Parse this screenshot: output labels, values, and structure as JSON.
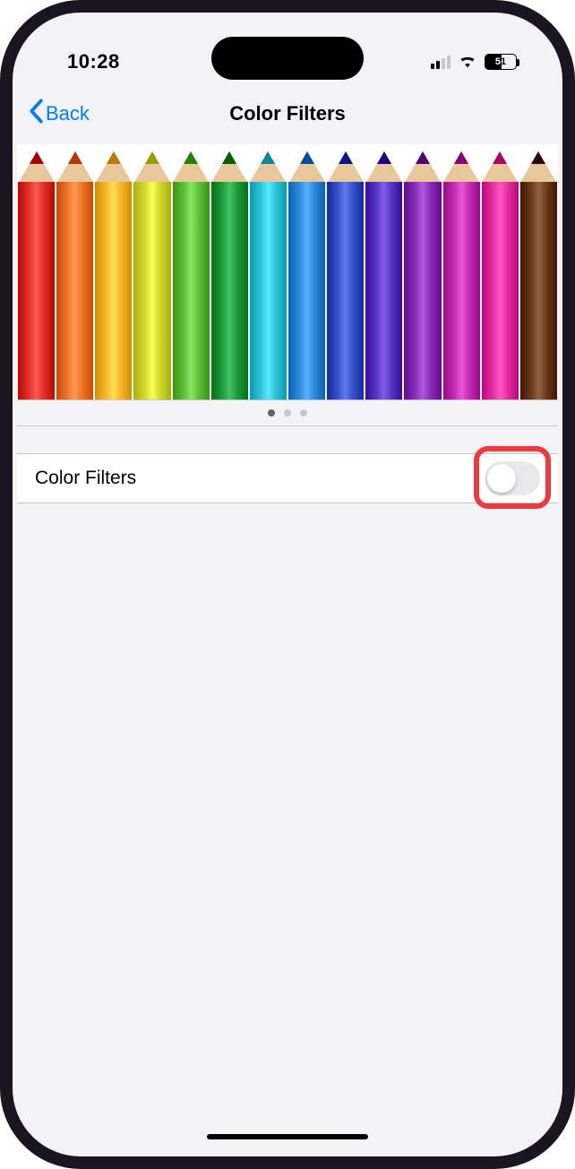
{
  "status_bar": {
    "time": "10:28",
    "battery_level": "51"
  },
  "nav": {
    "back_label": "Back",
    "title": "Color Filters"
  },
  "preview": {
    "pencil_colors": [
      "#e3312a",
      "#f0732a",
      "#f6b72a",
      "#d3d82f",
      "#5fbf3a",
      "#1f9a3c",
      "#2ec3d9",
      "#2f8ad9",
      "#3a52c9",
      "#5a34c2",
      "#8a2fb8",
      "#c22fb2",
      "#e52fa0",
      "#6b3b1c"
    ],
    "active_page_index": 0,
    "page_count": 3
  },
  "settings": {
    "color_filters_label": "Color Filters",
    "color_filters_on": false
  },
  "annotation": {
    "color": "#ec3a3f"
  }
}
